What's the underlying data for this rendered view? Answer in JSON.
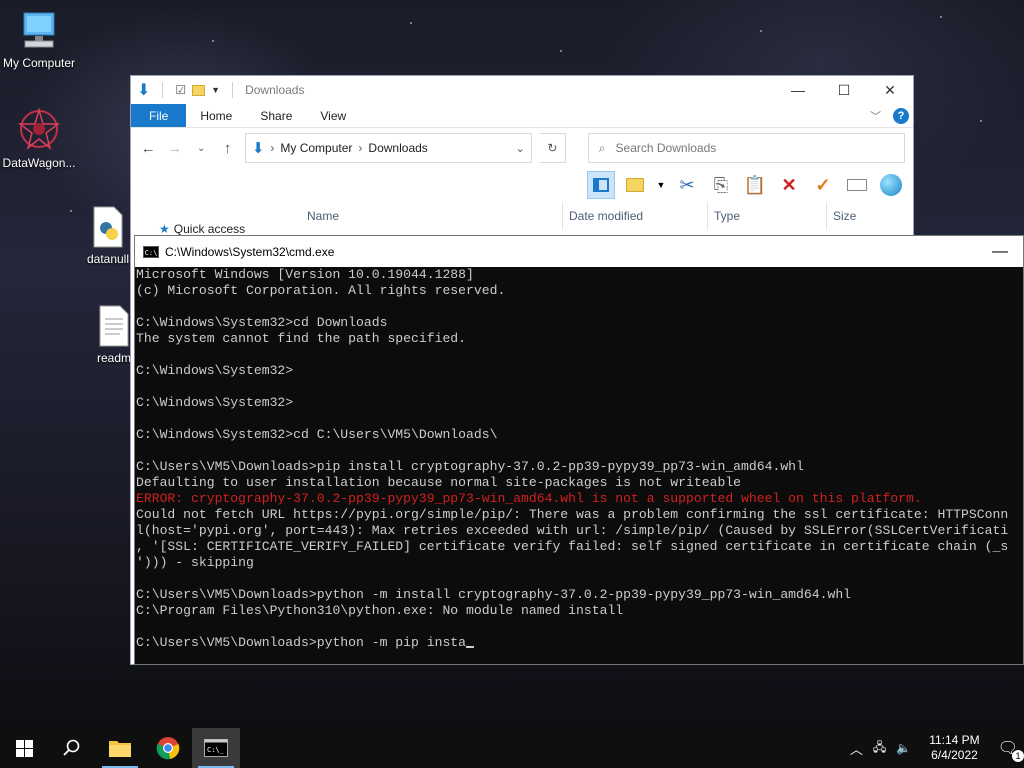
{
  "desktop": {
    "icons": [
      {
        "label": "My Computer"
      },
      {
        "label": "DataWagon..."
      },
      {
        "label": "datanull"
      },
      {
        "label": "readm"
      }
    ]
  },
  "explorer": {
    "title": "Downloads",
    "tabs": [
      "File",
      "Home",
      "Share",
      "View"
    ],
    "breadcrumb": [
      "My Computer",
      "Downloads"
    ],
    "search_placeholder": "Search Downloads",
    "columns": [
      "Name",
      "Date modified",
      "Type",
      "Size"
    ],
    "sidebar_quick_access": "Quick access"
  },
  "cmd": {
    "title": "C:\\Windows\\System32\\cmd.exe",
    "lines": [
      {
        "text": "Microsoft Windows [Version 10.0.19044.1288]",
        "type": "normal"
      },
      {
        "text": "(c) Microsoft Corporation. All rights reserved.",
        "type": "normal"
      },
      {
        "text": "",
        "type": "normal"
      },
      {
        "text": "C:\\Windows\\System32>cd Downloads",
        "type": "normal"
      },
      {
        "text": "The system cannot find the path specified.",
        "type": "normal"
      },
      {
        "text": "",
        "type": "normal"
      },
      {
        "text": "C:\\Windows\\System32>",
        "type": "normal"
      },
      {
        "text": "",
        "type": "normal"
      },
      {
        "text": "C:\\Windows\\System32>",
        "type": "normal"
      },
      {
        "text": "",
        "type": "normal"
      },
      {
        "text": "C:\\Windows\\System32>cd C:\\Users\\VM5\\Downloads\\",
        "type": "normal"
      },
      {
        "text": "",
        "type": "normal"
      },
      {
        "text": "C:\\Users\\VM5\\Downloads>pip install cryptography-37.0.2-pp39-pypy39_pp73-win_amd64.whl",
        "type": "normal"
      },
      {
        "text": "Defaulting to user installation because normal site-packages is not writeable",
        "type": "normal"
      },
      {
        "text": "ERROR: cryptography-37.0.2-pp39-pypy39_pp73-win_amd64.whl is not a supported wheel on this platform.",
        "type": "error"
      },
      {
        "text": "Could not fetch URL https://pypi.org/simple/pip/: There was a problem confirming the ssl certificate: HTTPSConn",
        "type": "normal"
      },
      {
        "text": "l(host='pypi.org', port=443): Max retries exceeded with url: /simple/pip/ (Caused by SSLError(SSLCertVerificati",
        "type": "normal"
      },
      {
        "text": ", '[SSL: CERTIFICATE_VERIFY_FAILED] certificate verify failed: self signed certificate in certificate chain (_s",
        "type": "normal"
      },
      {
        "text": "'))) - skipping",
        "type": "normal"
      },
      {
        "text": "",
        "type": "normal"
      },
      {
        "text": "C:\\Users\\VM5\\Downloads>python -m install cryptography-37.0.2-pp39-pypy39_pp73-win_amd64.whl",
        "type": "normal"
      },
      {
        "text": "C:\\Program Files\\Python310\\python.exe: No module named install",
        "type": "normal"
      },
      {
        "text": "",
        "type": "normal"
      }
    ],
    "current_input": "C:\\Users\\VM5\\Downloads>python -m pip insta"
  },
  "taskbar": {
    "time": "11:14 PM",
    "date": "6/4/2022",
    "notification_count": "1"
  }
}
